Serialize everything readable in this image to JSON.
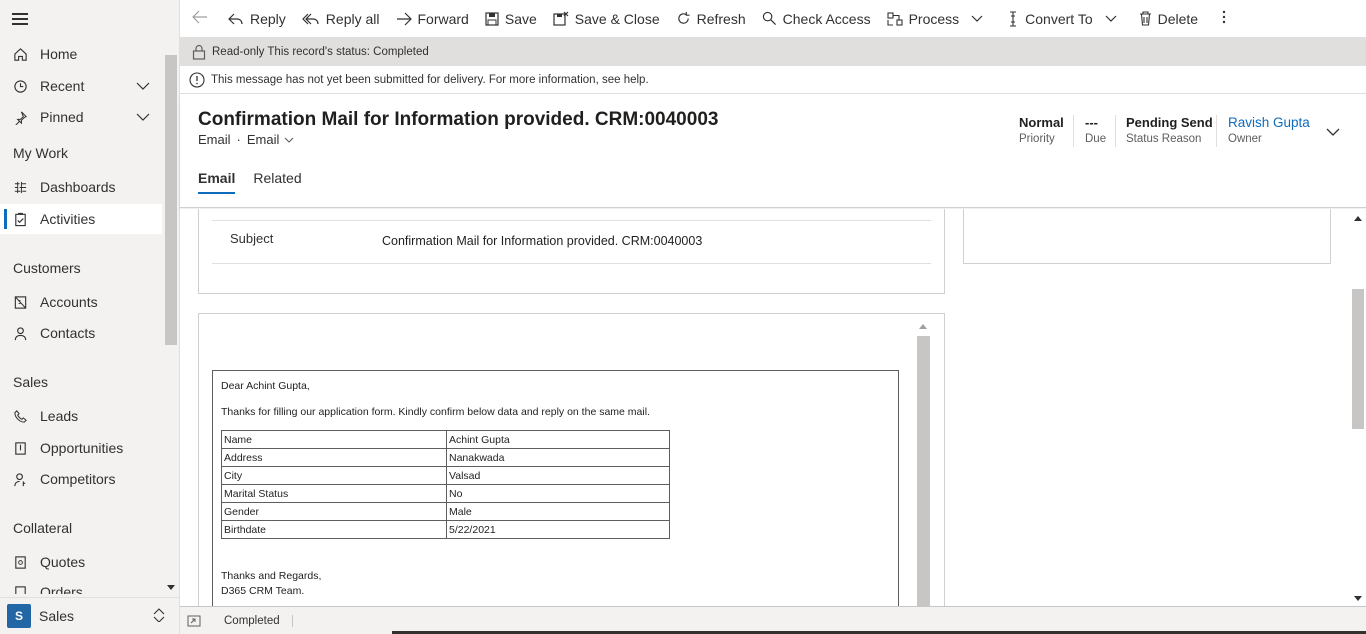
{
  "sidebar": {
    "items": [
      {
        "label": "Home",
        "icon": "home-icon"
      },
      {
        "label": "Recent",
        "icon": "clock-icon"
      },
      {
        "label": "Pinned",
        "icon": "pin-icon"
      },
      {
        "label": "Dashboards",
        "icon": "dashboard-icon"
      },
      {
        "label": "Activities",
        "icon": "clipboard-icon"
      },
      {
        "label": "Accounts",
        "icon": "building-icon"
      },
      {
        "label": "Contacts",
        "icon": "person-icon"
      },
      {
        "label": "Leads",
        "icon": "phone-icon"
      },
      {
        "label": "Opportunities",
        "icon": "document-icon"
      },
      {
        "label": "Competitors",
        "icon": "person-key-icon"
      },
      {
        "label": "Quotes",
        "icon": "quote-icon"
      },
      {
        "label": "Orders",
        "icon": "order-icon"
      }
    ],
    "groups": {
      "my_work": "My Work",
      "customers": "Customers",
      "sales": "Sales",
      "collateral": "Collateral"
    },
    "area": {
      "badge": "S",
      "label": "Sales"
    }
  },
  "toolbar": {
    "reply": "Reply",
    "reply_all": "Reply all",
    "forward": "Forward",
    "save": "Save",
    "save_close": "Save & Close",
    "refresh": "Refresh",
    "check_access": "Check Access",
    "process": "Process",
    "convert_to": "Convert To",
    "delete": "Delete"
  },
  "notifications": {
    "readonly": "Read-only This record's status: Completed",
    "not_submitted": "This message has not yet been submitted for delivery. For more information, see help."
  },
  "header": {
    "title": "Confirmation Mail for Information provided. CRM:0040003",
    "entity": "Email",
    "form": "Email",
    "fields": [
      {
        "value": "Normal",
        "label": "Priority"
      },
      {
        "value": "---",
        "label": "Due"
      },
      {
        "value": "Pending Send",
        "label": "Status Reason"
      },
      {
        "value": "Ravish Gupta",
        "label": "Owner"
      }
    ],
    "tabs": [
      "Email",
      "Related"
    ]
  },
  "form": {
    "subject_label": "Subject",
    "subject_value": "Confirmation Mail for Information provided. CRM:0040003"
  },
  "email_body": {
    "greeting": "Dear Achint Gupta,",
    "intro": "Thanks for filling our application form. Kindly confirm below data and reply on the same mail.",
    "rows": [
      [
        "Name",
        "Achint Gupta"
      ],
      [
        "Address",
        "Nanakwada"
      ],
      [
        "City",
        "Valsad"
      ],
      [
        "Marital Status",
        "No"
      ],
      [
        "Gender",
        "Male"
      ],
      [
        "Birthdate",
        "5/22/2021"
      ]
    ],
    "closing": "Thanks and Regards,",
    "signature": "D365 CRM Team."
  },
  "footer": {
    "status": "Completed"
  },
  "colors": {
    "accent": "#0f6cbd",
    "area_badge": "#2266a6"
  }
}
